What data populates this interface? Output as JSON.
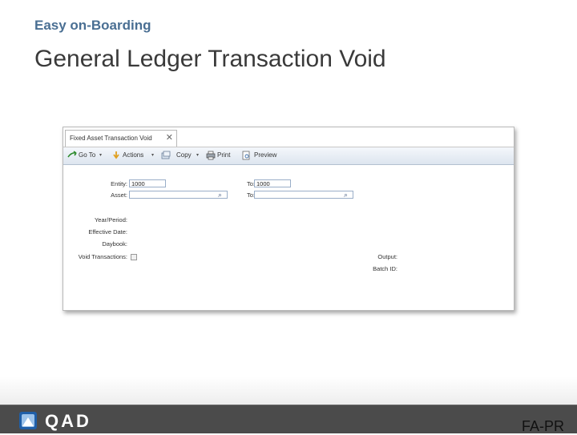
{
  "slide": {
    "tag": "Easy on-Boarding",
    "title": "General Ledger Transaction Void",
    "footer_code": "FA-PR"
  },
  "window": {
    "tab_title": "Fixed Asset Transaction Void",
    "toolbar": {
      "goto": "Go To",
      "actions": "Actions",
      "copy": "Copy",
      "print": "Print",
      "preview": "Preview"
    },
    "form": {
      "entity_label": "Entity:",
      "entity_value": "1000",
      "entity_to_label": "To:",
      "entity_to_value": "1000",
      "asset_label": "Asset:",
      "asset_to_label": "To:",
      "year_period_label": "Year/Period:",
      "effective_date_label": "Effective Date:",
      "daybook_label": "Daybook:",
      "void_transactions_label": "Void Transactions:",
      "output_label": "Output:",
      "batch_id_label": "Batch ID:"
    }
  },
  "logo": {
    "text": "QAD"
  },
  "colors": {
    "tag": "#4a6f93",
    "footer": "#4b4b4b",
    "toolbar_top": "#f4f7fb",
    "toolbar_bottom": "#dde5ef"
  }
}
